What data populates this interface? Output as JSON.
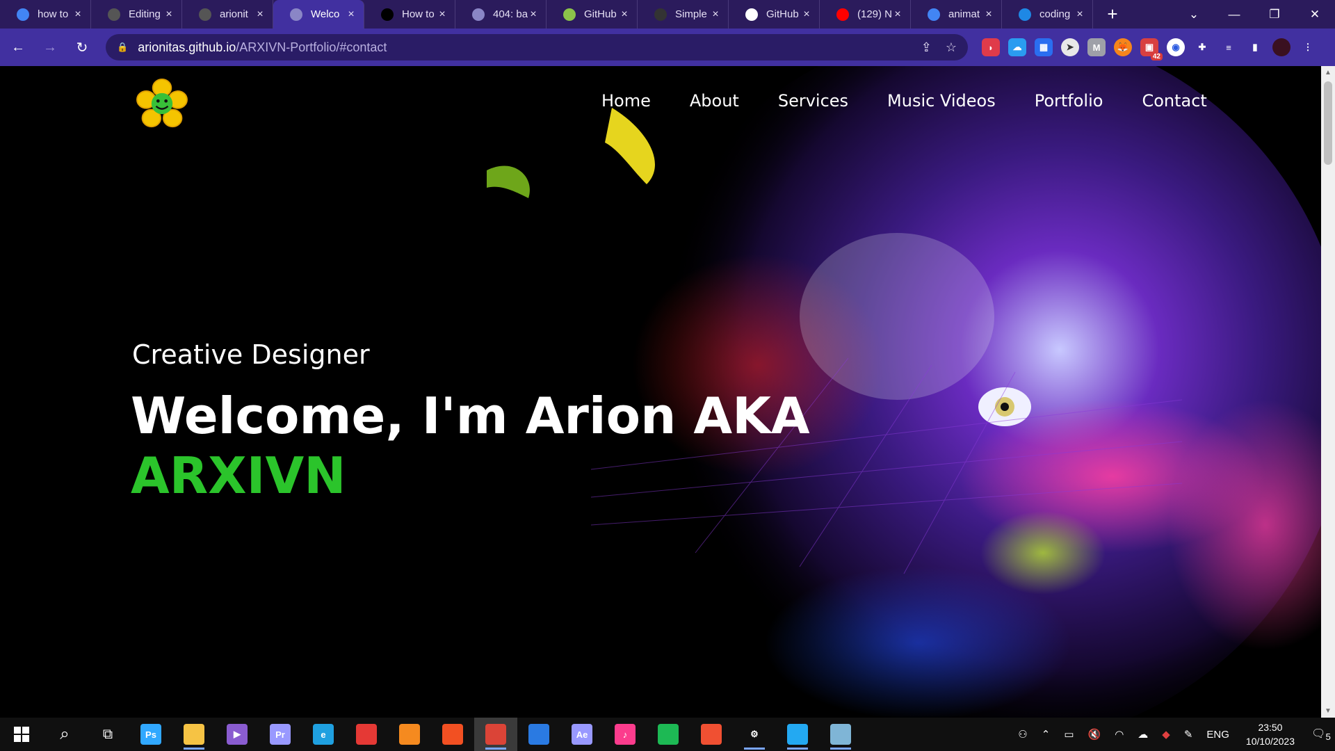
{
  "browser": {
    "tabs": [
      {
        "title": "how to",
        "icon": "google-icon",
        "color": "#4285f4"
      },
      {
        "title": "Editing",
        "icon": "github-icon",
        "color": "#555555"
      },
      {
        "title": "arionit",
        "icon": "github-icon",
        "color": "#555555"
      },
      {
        "title": "Welco",
        "icon": "globe-icon",
        "color": "#8a86c6",
        "active": true
      },
      {
        "title": "How to",
        "icon": "medium-icon",
        "color": "#000000"
      },
      {
        "title": "404: ba",
        "icon": "globe-icon",
        "color": "#8a86c6"
      },
      {
        "title": "GitHub",
        "icon": "github-icon",
        "color": "#8bc34a"
      },
      {
        "title": "Simple",
        "icon": "person-icon",
        "color": "#333333"
      },
      {
        "title": "GitHub",
        "icon": "github-icon",
        "color": "#ffffff"
      },
      {
        "title": "(129) N",
        "icon": "youtube-icon",
        "color": "#ff0000"
      },
      {
        "title": "animat",
        "icon": "google-icon",
        "color": "#4285f4"
      },
      {
        "title": "coding",
        "icon": "gif-icon",
        "color": "#1e88e5"
      }
    ],
    "new_tab": "+",
    "url_host": "arionitas.github.io",
    "url_path": "/ARXIVN-Portfolio/#contact",
    "extension_badge": "42"
  },
  "site": {
    "nav": [
      "Home",
      "About",
      "Services",
      "Music Videos",
      "Portfolio",
      "Contact"
    ],
    "subtitle": "Creative Designer",
    "headline": "Welcome, I'm Arion AKA",
    "accent_name": "ARXIVN",
    "accent_color": "#2bc42b"
  },
  "taskbar": {
    "apps": [
      {
        "name": "photoshop",
        "label": "Ps",
        "color": "#31a8ff"
      },
      {
        "name": "file-explorer",
        "label": "",
        "color": "#f6c344"
      },
      {
        "name": "media-player",
        "label": "▶",
        "color": "#8a5cd0"
      },
      {
        "name": "premiere",
        "label": "Pr",
        "color": "#9999ff"
      },
      {
        "name": "edge",
        "label": "e",
        "color": "#1fa0e0"
      },
      {
        "name": "gift",
        "label": "",
        "color": "#e53935"
      },
      {
        "name": "fl-studio",
        "label": "",
        "color": "#f58a1f"
      },
      {
        "name": "store",
        "label": "",
        "color": "#f25022"
      },
      {
        "name": "chrome",
        "label": "",
        "color": "#db4437"
      },
      {
        "name": "mail",
        "label": "",
        "color": "#2a7ae2"
      },
      {
        "name": "after-effects",
        "label": "Ae",
        "color": "#9999ff"
      },
      {
        "name": "itunes",
        "label": "♪",
        "color": "#fc3c8d"
      },
      {
        "name": "spotify",
        "label": "",
        "color": "#1db954"
      },
      {
        "name": "git",
        "label": "",
        "color": "#f05032"
      },
      {
        "name": "settings",
        "label": "⚙",
        "color": "#ffffff"
      },
      {
        "name": "vscode",
        "label": "",
        "color": "#23a9f2"
      },
      {
        "name": "notepad",
        "label": "",
        "color": "#7fb5d6"
      }
    ],
    "language": "ENG",
    "time": "23:50",
    "date": "10/10/2023",
    "notifications": "5"
  }
}
